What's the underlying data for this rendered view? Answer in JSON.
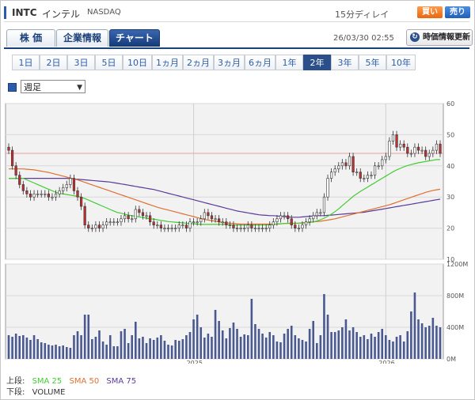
{
  "header": {
    "symbol": "INTC",
    "name": "インテル",
    "exchange": "NASDAQ",
    "delay": "15分ディレイ",
    "buy_label": "買い",
    "sell_label": "売り"
  },
  "tabs": [
    {
      "label": "株 価"
    },
    {
      "label": "企業情報"
    },
    {
      "label": "チャート"
    }
  ],
  "timestamp": "26/03/30 02:55",
  "refresh_label": "時価情報更新",
  "periods": [
    "1日",
    "2日",
    "3日",
    "5日",
    "10日",
    "1ヵ月",
    "2ヵ月",
    "3ヵ月",
    "6ヵ月",
    "1年",
    "2年",
    "3年",
    "5年",
    "10年"
  ],
  "active_period": "2年",
  "period_select": {
    "value": "週足"
  },
  "legend": {
    "upper_label": "上段:",
    "lower_label": "下段:",
    "sma25": "SMA 25",
    "sma50": "SMA 50",
    "sma75": "SMA 75",
    "volume": "VOLUME"
  },
  "colors": {
    "sma25": "#44cc33",
    "sma50": "#e07030",
    "sma75": "#5a3a9a",
    "candle_up": "#ffffff",
    "candle_down": "#c03030",
    "volume_bar": "#4a5a90",
    "ref_line": "#e8a0a0"
  },
  "chart_data": [
    {
      "type": "candlestick",
      "title": "",
      "x_tick_labels": [
        "2025",
        "2026"
      ],
      "y_tick_labels": [
        "10",
        "20",
        "30",
        "40",
        "50",
        "60"
      ],
      "ylim": [
        10,
        60
      ],
      "grid": true,
      "reference_line": 44,
      "closes": [
        45,
        40,
        37,
        34,
        32,
        31,
        30,
        31,
        31,
        31,
        31,
        30,
        30,
        31,
        32,
        33,
        34,
        36,
        32,
        30,
        27,
        21,
        20,
        20,
        21,
        20,
        21,
        22,
        22,
        22,
        22,
        23,
        24,
        23,
        23,
        26,
        25,
        24,
        24,
        22,
        21,
        21,
        20,
        20,
        20,
        20,
        20,
        21,
        21,
        20,
        22,
        22,
        22,
        23,
        25,
        24,
        23,
        23,
        22,
        22,
        21,
        21,
        20,
        20,
        20,
        20,
        21,
        20,
        20,
        20,
        20,
        20,
        21,
        22,
        23,
        24,
        24,
        23,
        21,
        20,
        20,
        21,
        22,
        23,
        24,
        25,
        25,
        30,
        36,
        38,
        39,
        40,
        41,
        40,
        43,
        38,
        38,
        36,
        36,
        37,
        37,
        40,
        40,
        42,
        43,
        48,
        50,
        46,
        47,
        46,
        44,
        44,
        46,
        45,
        45,
        43,
        44,
        45,
        47,
        44
      ],
      "sma25": [
        36,
        36,
        36,
        36,
        36,
        35.5,
        35,
        34.5,
        34,
        33.5,
        33,
        32.5,
        32,
        31.5,
        31.2,
        31,
        30.8,
        30.6,
        30.4,
        30.2,
        29.9,
        29.5,
        29,
        28.5,
        28,
        27.5,
        27,
        26.5,
        26,
        25.5,
        25,
        24.8,
        24.5,
        24.2,
        24,
        23.8,
        23.6,
        23.4,
        23.2,
        23,
        22.9,
        22.7,
        22.5,
        22.3,
        22.1,
        22,
        21.9,
        21.8,
        21.7,
        21.6,
        21.5,
        21.4,
        21.3,
        21.2,
        21.2,
        21.2,
        21.2,
        21.2,
        21.2,
        21.2,
        21.2,
        21.1,
        21,
        21,
        21,
        21,
        21,
        21,
        21,
        21,
        21,
        21,
        21.1,
        21.2,
        21.3,
        21.4,
        21.5,
        21.6,
        21.6,
        21.6,
        21.6,
        21.6,
        21.7,
        21.8,
        22,
        22.3,
        22.7,
        23.2,
        23.8,
        24.5,
        25.3,
        26.2,
        27.2,
        28.2,
        29.2,
        30.2,
        31,
        31.8,
        32.5,
        33.2,
        33.9,
        34.6,
        35.3,
        36,
        36.7,
        37.4,
        38.1,
        38.7,
        39.2,
        39.7,
        40.1,
        40.4,
        40.7,
        41,
        41.2,
        41.4,
        41.6,
        41.8,
        42,
        42
      ],
      "sma50": [
        39,
        39,
        39,
        39,
        39,
        38.9,
        38.8,
        38.7,
        38.5,
        38.3,
        38.1,
        37.9,
        37.6,
        37.3,
        37,
        36.7,
        36.4,
        36.1,
        35.8,
        35.5,
        35.1,
        34.7,
        34.3,
        33.9,
        33.5,
        33.1,
        32.7,
        32.3,
        31.9,
        31.5,
        31.1,
        30.7,
        30.3,
        29.9,
        29.5,
        29.1,
        28.7,
        28.3,
        27.9,
        27.5,
        27.1,
        26.7,
        26.4,
        26.1,
        25.8,
        25.5,
        25.2,
        24.9,
        24.6,
        24.3,
        24,
        23.7,
        23.4,
        23.1,
        22.8,
        22.6,
        22.4,
        22.2,
        22,
        21.8,
        21.7,
        21.6,
        21.5,
        21.4,
        21.3,
        21.3,
        21.3,
        21.3,
        21.3,
        21.3,
        21.3,
        21.3,
        21.3,
        21.3,
        21.3,
        21.4,
        21.5,
        21.5,
        21.5,
        21.5,
        21.6,
        21.7,
        21.8,
        21.9,
        22,
        22.1,
        22.2,
        22.4,
        22.6,
        22.8,
        23,
        23.3,
        23.6,
        23.9,
        24.2,
        24.5,
        24.8,
        25.1,
        25.4,
        25.7,
        26,
        26.3,
        26.6,
        26.9,
        27.2,
        27.5,
        27.9,
        28.3,
        28.7,
        29.1,
        29.5,
        29.9,
        30.3,
        30.7,
        31.1,
        31.5,
        31.8,
        32.1,
        32.3,
        32.5
      ],
      "sma75": [
        36,
        36,
        36,
        36,
        36,
        36,
        36,
        36,
        36,
        36,
        36,
        36,
        36,
        36,
        36,
        36,
        36,
        35.9,
        35.8,
        35.7,
        35.6,
        35.5,
        35.4,
        35.3,
        35.2,
        35.1,
        35,
        34.9,
        34.8,
        34.6,
        34.4,
        34.2,
        34,
        33.8,
        33.6,
        33.4,
        33.2,
        33,
        32.8,
        32.6,
        32.4,
        32.1,
        31.8,
        31.5,
        31.2,
        30.9,
        30.6,
        30.3,
        30,
        29.7,
        29.4,
        29.1,
        28.8,
        28.5,
        28.2,
        27.9,
        27.6,
        27.3,
        27,
        26.7,
        26.4,
        26.1,
        25.8,
        25.5,
        25.3,
        25.1,
        24.9,
        24.7,
        24.5,
        24.3,
        24.2,
        24.1,
        24,
        24,
        23.9,
        23.8,
        23.7,
        23.6,
        23.5,
        23.5,
        23.5,
        23.6,
        23.7,
        23.8,
        23.9,
        24,
        24,
        24,
        24.1,
        24.2,
        24.3,
        24.4,
        24.5,
        24.6,
        24.7,
        24.8,
        24.9,
        25,
        25.1,
        25.3,
        25.5,
        25.7,
        25.9,
        26.1,
        26.3,
        26.5,
        26.7,
        26.9,
        27.1,
        27.3,
        27.5,
        27.7,
        27.9,
        28.1,
        28.3,
        28.5,
        28.7,
        28.9,
        29.1,
        29.3
      ]
    },
    {
      "type": "bar",
      "title": "",
      "y_tick_labels": [
        "0M",
        "400M",
        "800M",
        "1200M"
      ],
      "ylim": [
        0,
        1200
      ],
      "grid": true,
      "values": [
        300,
        280,
        320,
        290,
        300,
        270,
        240,
        300,
        250,
        210,
        200,
        180,
        170,
        180,
        160,
        170,
        150,
        140,
        300,
        350,
        300,
        560,
        560,
        250,
        280,
        360,
        220,
        180,
        300,
        160,
        160,
        350,
        380,
        200,
        300,
        470,
        260,
        280,
        200,
        260,
        240,
        270,
        300,
        230,
        180,
        170,
        240,
        230,
        250,
        300,
        340,
        500,
        560,
        400,
        270,
        320,
        280,
        620,
        480,
        360,
        260,
        390,
        460,
        380,
        280,
        310,
        300,
        760,
        440,
        380,
        320,
        270,
        340,
        300,
        220,
        210,
        320,
        380,
        420,
        300,
        260,
        240,
        220,
        380,
        480,
        200,
        300,
        820,
        560,
        340,
        340,
        360,
        400,
        500,
        360,
        400,
        340,
        280,
        300,
        250,
        320,
        280,
        340,
        380,
        300,
        240,
        220,
        280,
        300,
        220,
        350,
        600,
        840,
        500,
        450,
        400,
        420,
        520,
        420,
        400
      ]
    }
  ]
}
